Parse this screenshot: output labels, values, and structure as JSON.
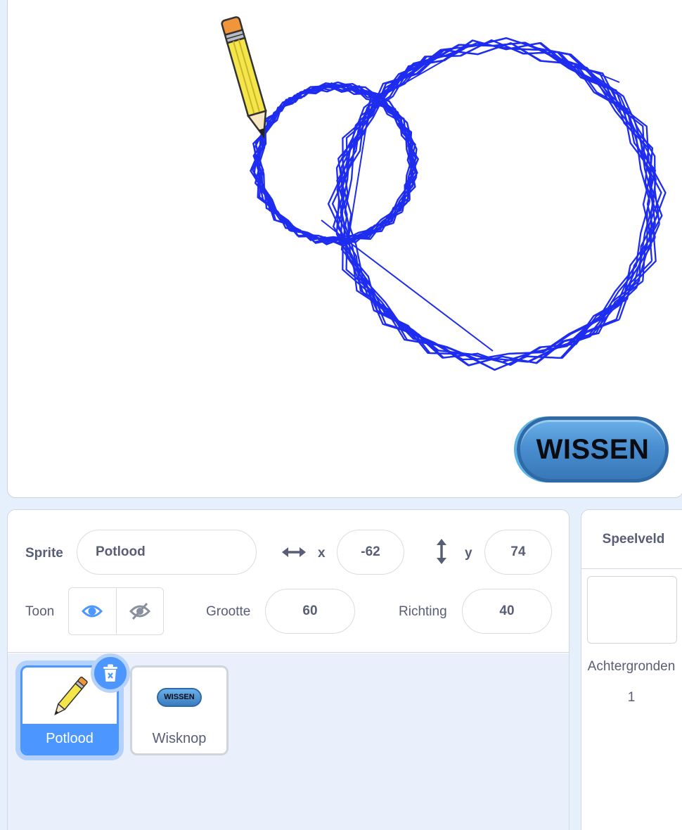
{
  "colors": {
    "pen": "#1e2cf0",
    "accent": "#4c97ff",
    "text": "#575e75",
    "panel_bg": "#e6effc"
  },
  "stage": {
    "button_label": "WISSEN"
  },
  "sprite_info": {
    "sprite_label": "Sprite",
    "sprite_name": "Potlood",
    "x_label": "x",
    "x_value": "-62",
    "y_label": "y",
    "y_value": "74",
    "show_label": "Toon",
    "size_label": "Grootte",
    "size_value": "60",
    "direction_label": "Richting",
    "direction_value": "40",
    "icons": {
      "x": "horizontal-arrows-icon",
      "y": "vertical-arrows-icon",
      "show": "eye-icon",
      "hide": "eye-slash-icon"
    }
  },
  "sprites": [
    {
      "name": "Potlood",
      "selected": true,
      "thumb_icon": "pencil-icon"
    },
    {
      "name": "Wisknop",
      "selected": false,
      "thumb_label": "WISSEN"
    }
  ],
  "stage_panel": {
    "title": "Speelveld",
    "backdrops_label": "Achtergronden",
    "backdrops_count": "1"
  }
}
